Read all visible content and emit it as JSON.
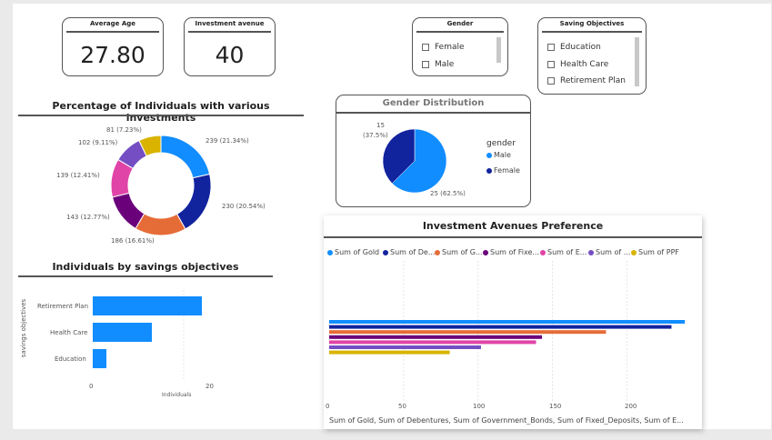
{
  "cards": {
    "average_age": {
      "title": "Average Age",
      "value": "27.80"
    },
    "investment_avenue": {
      "title": "Investment avenue",
      "value": "40"
    }
  },
  "gender_slicer": {
    "title": "Gender",
    "items": [
      "Female",
      "Male"
    ]
  },
  "saving_slicer": {
    "title": "Saving Objectives",
    "items": [
      "Education",
      "Health Care",
      "Retirement Plan"
    ]
  },
  "donut": {
    "title": "Percentage of Individuals with various investments",
    "labels": [
      "239 (21.34%)",
      "230 (20.54%)",
      "186 (16.61%)",
      "143 (12.77%)",
      "139 (12.41%)",
      "102 (9.11%)",
      "81 (7.23%)"
    ]
  },
  "gender_pie": {
    "title": "Gender Distribution",
    "legend_title": "gender",
    "legend": [
      "Male",
      "Female"
    ],
    "label_female_count": "15",
    "label_female_pct": "(37.5%)",
    "label_male": "25 (62.5%)"
  },
  "savings_bar": {
    "title": "Individuals by savings objectives",
    "ylabel": "savings objectives",
    "xlabel": "Individuals",
    "categories": [
      "Retirement Plan",
      "Health Care",
      "Education"
    ],
    "ticks": [
      "0",
      "20"
    ]
  },
  "investment_bar": {
    "title": "Investment Avenues Preference",
    "legend": [
      "Sum of Gold",
      "Sum of De...",
      "Sum of G...",
      "Sum of Fixe...",
      "Sum of E...",
      "Sum of ...",
      "Sum of PPF"
    ],
    "ticks": [
      "0",
      "50",
      "100",
      "150",
      "200"
    ],
    "xlabel": "Sum of Gold, Sum of Debentures, Sum of Government_Bonds, Sum of Fixed_Deposits, Sum of E..."
  },
  "colors": {
    "blue": "#118dff",
    "navy": "#12239e",
    "orange": "#e66c37",
    "purple": "#6b007b",
    "pink": "#e044a7",
    "violet": "#744ec2",
    "gold": "#d9b300"
  },
  "chart_data": [
    {
      "type": "pie",
      "title": "Percentage of Individuals with various investments",
      "values": [
        239,
        230,
        186,
        143,
        139,
        102,
        81
      ],
      "colors": [
        "#118dff",
        "#12239e",
        "#e66c37",
        "#6b007b",
        "#e044a7",
        "#744ec2",
        "#d9b300"
      ],
      "donut": true
    },
    {
      "type": "pie",
      "title": "Gender Distribution",
      "categories": [
        "Male",
        "Female"
      ],
      "values": [
        25,
        15
      ],
      "colors": [
        "#118dff",
        "#12239e"
      ]
    },
    {
      "type": "bar",
      "title": "Individuals by savings objectives",
      "orientation": "horizontal",
      "categories": [
        "Retirement Plan",
        "Health Care",
        "Education"
      ],
      "values": [
        24,
        13,
        3
      ],
      "xlim": [
        0,
        28
      ],
      "color": "#118dff"
    },
    {
      "type": "bar",
      "title": "Investment Avenues Preference",
      "orientation": "horizontal",
      "series": [
        {
          "name": "Sum of Gold",
          "values": [
            239
          ]
        },
        {
          "name": "Sum of Debentures",
          "values": [
            230
          ]
        },
        {
          "name": "Sum of Government_Bonds",
          "values": [
            186
          ]
        },
        {
          "name": "Sum of Fixed_Deposits",
          "values": [
            143
          ]
        },
        {
          "name": "Sum of E...",
          "values": [
            139
          ]
        },
        {
          "name": "Sum of ...",
          "values": [
            102
          ]
        },
        {
          "name": "Sum of PPF",
          "values": [
            81
          ]
        }
      ],
      "xlim": [
        0,
        245
      ],
      "grid": true
    }
  ]
}
